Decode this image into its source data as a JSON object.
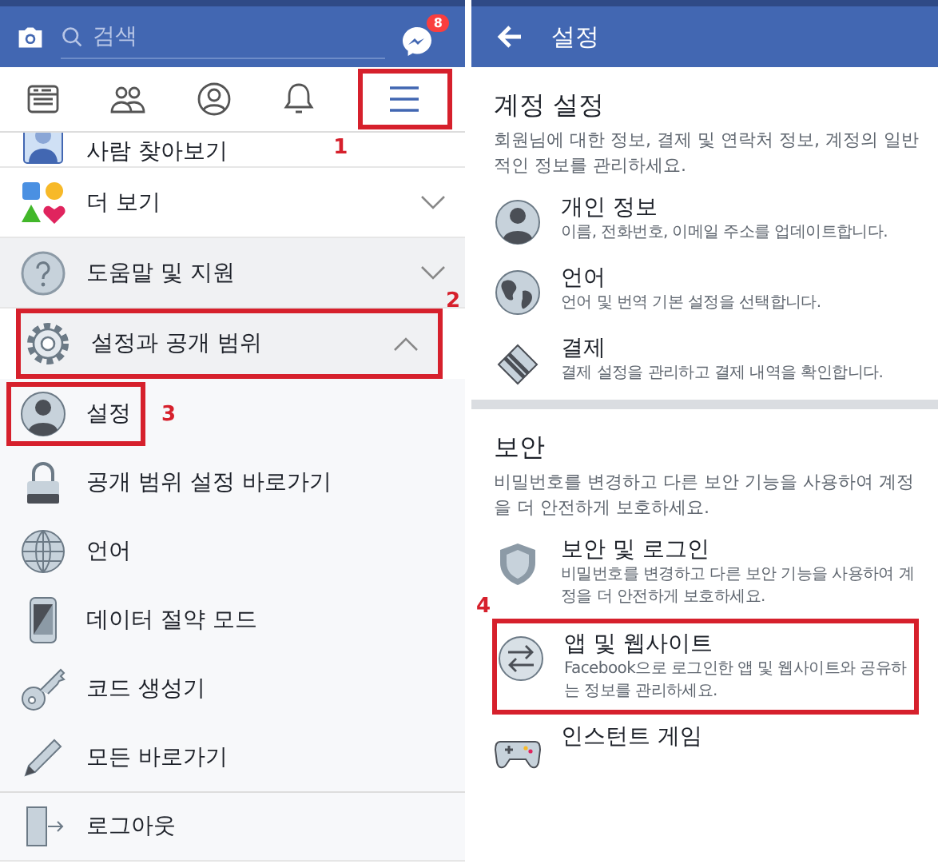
{
  "left": {
    "search": {
      "placeholder": "검색"
    },
    "messenger_badge": "8",
    "nav_tabs": [
      {
        "kind": "news",
        "selected": false
      },
      {
        "kind": "friends",
        "selected": false
      },
      {
        "kind": "profile",
        "selected": false
      },
      {
        "kind": "bell",
        "selected": false
      },
      {
        "kind": "menu",
        "selected": true,
        "highlighted": true,
        "annotation": "1"
      }
    ],
    "menu": [
      {
        "label": "사람 찾아보기",
        "kind": "people",
        "cut": true
      },
      {
        "label": "더 보기",
        "kind": "shapes",
        "expanded": false
      },
      {
        "label": "도움말 및 지원",
        "kind": "help",
        "expanded": false
      },
      {
        "label": "설정과 공개 범위",
        "kind": "gear",
        "expanded": true,
        "highlighted": true,
        "annotation": "2",
        "children": [
          {
            "label": "설정",
            "kind": "person",
            "highlighted": true,
            "annotation": "3"
          },
          {
            "label": "공개 범위 설정 바로가기",
            "kind": "lock"
          },
          {
            "label": "언어",
            "kind": "globe"
          },
          {
            "label": "데이터 절약 모드",
            "kind": "phone"
          },
          {
            "label": "코드 생성기",
            "kind": "key"
          },
          {
            "label": "모든 바로가기",
            "kind": "pencil"
          }
        ]
      },
      {
        "label": "로그아웃",
        "kind": "door"
      }
    ]
  },
  "right": {
    "title": "설정",
    "sections": [
      {
        "heading": "계정 설정",
        "description": "회원님에 대한 정보, 결제 및 연락처 정보, 계정의 일반적인 정보를 관리하세요.",
        "items": [
          {
            "title": "개인 정보",
            "description": "이름, 전화번호, 이메일 주소를 업데이트합니다.",
            "kind": "person"
          },
          {
            "title": "언어",
            "description": "언어 및 번역 기본 설정을 선택합니다.",
            "kind": "earth"
          },
          {
            "title": "결제",
            "description": "결제 설정을 관리하고 결제 내역을 확인합니다.",
            "kind": "card"
          }
        ]
      },
      {
        "heading": "보안",
        "description": "비밀번호를 변경하고 다른 보안 기능을 사용하여 계정을 더 안전하게 보호하세요.",
        "items": [
          {
            "title": "보안 및 로그인",
            "description": "비밀번호를 변경하고 다른 보안 기능을 사용하여 계정을 더 안전하게 보호하세요.",
            "kind": "shield"
          },
          {
            "title": "앱 및 웹사이트",
            "description": "Facebook으로 로그인한 앱 및 웹사이트와 공유하는 정보를 관리하세요.",
            "kind": "arrows",
            "highlighted": true,
            "annotation": "4"
          },
          {
            "title": "인스턴트 게임",
            "kind": "gamepad"
          }
        ]
      }
    ]
  }
}
